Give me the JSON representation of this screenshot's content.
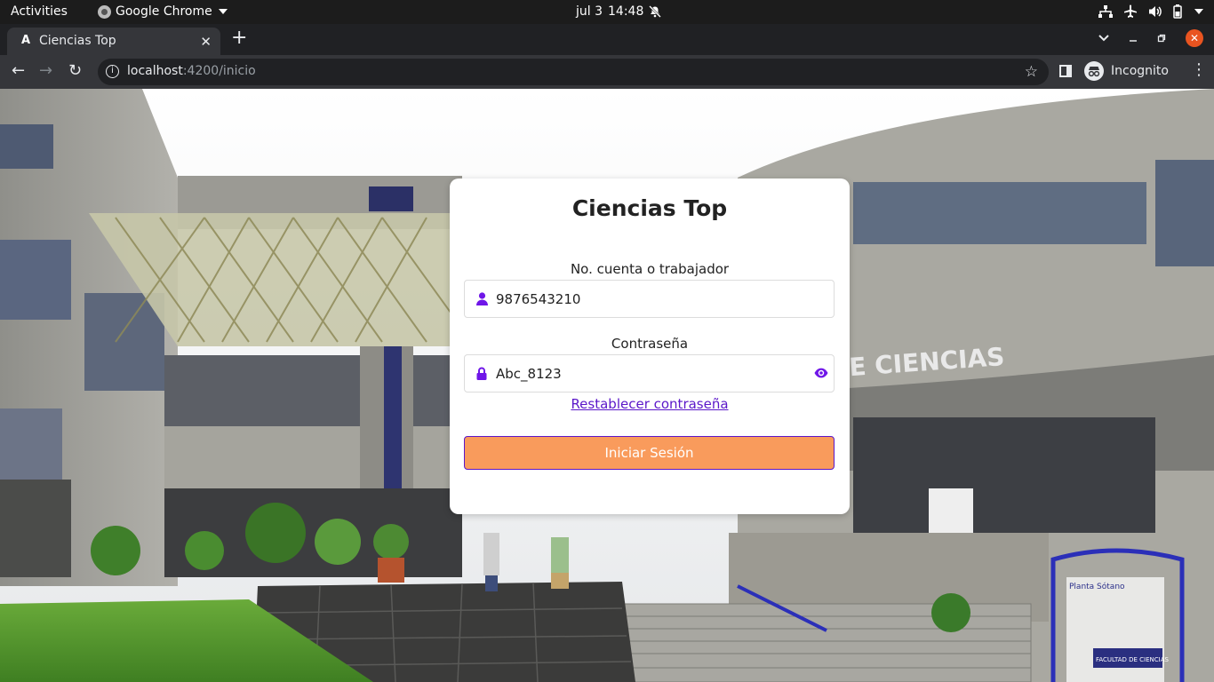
{
  "os_bar": {
    "activities": "Activities",
    "app_name": "Google Chrome",
    "date": "jul 3",
    "time": "14:48"
  },
  "browser": {
    "tab_title": "Ciencias Top",
    "tab_favicon": "A",
    "new_tab_label": "+",
    "url_host": "localhost",
    "url_rest": ":4200/inicio",
    "profile_label": "Incognito"
  },
  "login": {
    "title": "Ciencias Top",
    "account_label": "No. cuenta o trabajador",
    "account_value": "9876543210",
    "password_label": "Contraseña",
    "password_value": "Abc_8123",
    "reset_link": "Restablecer contraseña",
    "submit_label": "Iniciar Sesión"
  },
  "background": {
    "sign_text": "E CIENCIAS",
    "floor_sign": "Planta Sótano",
    "plaque": "FACULTAD DE CIENCIAS"
  },
  "colors": {
    "accent": "#6f16e8",
    "submit_bg": "#f99b5c",
    "link": "#5b17c9"
  },
  "icons": {
    "account_field": "user-icon",
    "password_field": "lock-icon",
    "toggle_visibility": "eye-icon"
  }
}
